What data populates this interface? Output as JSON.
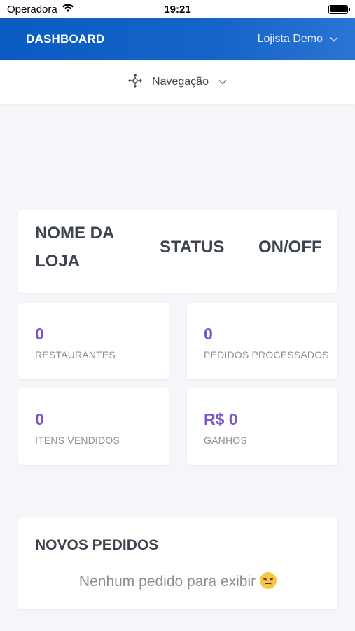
{
  "status_bar": {
    "carrier": "Operadora",
    "time": "19:21"
  },
  "header": {
    "brand": "DASHBOARD",
    "user_name": "Lojista Demo"
  },
  "navigation": {
    "label": "Navegação"
  },
  "store_table": {
    "headers": [
      "NOME DA LOJA",
      "STATUS",
      "ON/OFF"
    ]
  },
  "stats": [
    {
      "value": "0",
      "label": "RESTAURANTES"
    },
    {
      "value": "0",
      "label": "PEDIDOS PROCESSADOS"
    },
    {
      "value": "0",
      "label": "ITENS VENDIDOS"
    },
    {
      "value": "R$ 0",
      "label": "GANHOS"
    }
  ],
  "orders": {
    "title": "NOVOS PEDIDOS",
    "empty_message": "Nenhum pedido para exibir"
  },
  "colors": {
    "header_blue": "#0a5cc2",
    "accent_purple": "#7b55c7"
  },
  "icons": {
    "wifi": "wifi-icon",
    "battery": "battery-icon",
    "user_chevron": "chevron-down-icon",
    "nav": "compass-icon",
    "emoji": "disappointed-face-icon"
  }
}
